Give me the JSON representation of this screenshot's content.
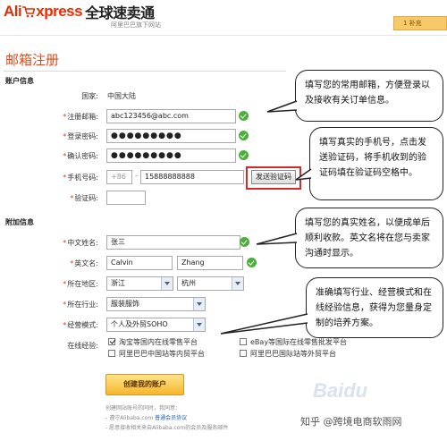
{
  "header": {
    "logo_ali": "Ali",
    "logo_express": "xpress",
    "logo_cn": "全球速卖通",
    "tagline": "阿里巴巴旗下网站",
    "step": "1 补充"
  },
  "page_title": "邮箱注册",
  "account_section": {
    "title": "账户信息",
    "country_label": "国家:",
    "country_value": "中国大陆",
    "email_label": "注册邮箱:",
    "email_value": "abc123456@abc.com",
    "password_label": "登录密码:",
    "password_value": "●●●●●●●●●",
    "confirm_label": "确认密码:",
    "confirm_value": "●●●●●●●●●",
    "phone_label": "手机号码:",
    "phone_prefix": "+86",
    "phone_value": "15888888888",
    "sms_button": "发送验证码",
    "code_label": "验证码:",
    "code_value": ""
  },
  "extra_section": {
    "title": "附加信息",
    "cn_name_label": "中文姓名:",
    "cn_name_value": "张三",
    "en_name_label": "英文名:",
    "first_name_value": "Calvin",
    "last_name_value": "Zhang",
    "region_label": "所在地区:",
    "province_value": "浙江",
    "city_value": "杭州",
    "industry_label": "所在行业:",
    "industry_value": "服装服饰",
    "mode_label": "经营模式:",
    "mode_value": "个人及外贸SOHO",
    "exp_label": "在线经验:",
    "exp_options": [
      {
        "label": "淘宝等国内在线零售平台",
        "checked": true
      },
      {
        "label": "eBay等国际在线零售批发平台",
        "checked": false
      },
      {
        "label": "阿里巴巴中国站等内贸平台",
        "checked": false
      },
      {
        "label": "阿里巴巴国际站等外贸平台",
        "checked": false
      }
    ]
  },
  "create_button": "创建我的账户",
  "footnote": {
    "line1": "创建网站账号的同时，我同意：",
    "line2_prefix": "- 遵守Alibaba.com ",
    "line2_link": "普通会员协议",
    "line3": "- 愿意接收相关来自Alibaba.com的会员及服务邮件"
  },
  "callouts": [
    "填写您的常用邮箱，方便登录以及接收有关订单信息。",
    "填写真实的手机号，点击发送验证码，将手机收到的验证码填在验证码空格中。",
    "填写您的真实姓名，以便成单后顺利收款。英文名将在您与卖家沟通时显示。",
    "准确填写行业、经营模式和在线经验信息，获得为您量身定制的培养方案。"
  ],
  "watermarks": {
    "baidu": "Baidu",
    "zhihu": "知乎 @跨境电商软雨网"
  },
  "colors": {
    "brand_red": "#e62e04",
    "title_orange": "#e24a1a",
    "required_star": "#e6331b",
    "ok_green": "#4cae3b",
    "button_gold": "#f7b52c",
    "highlight_red": "#d42a2a"
  }
}
